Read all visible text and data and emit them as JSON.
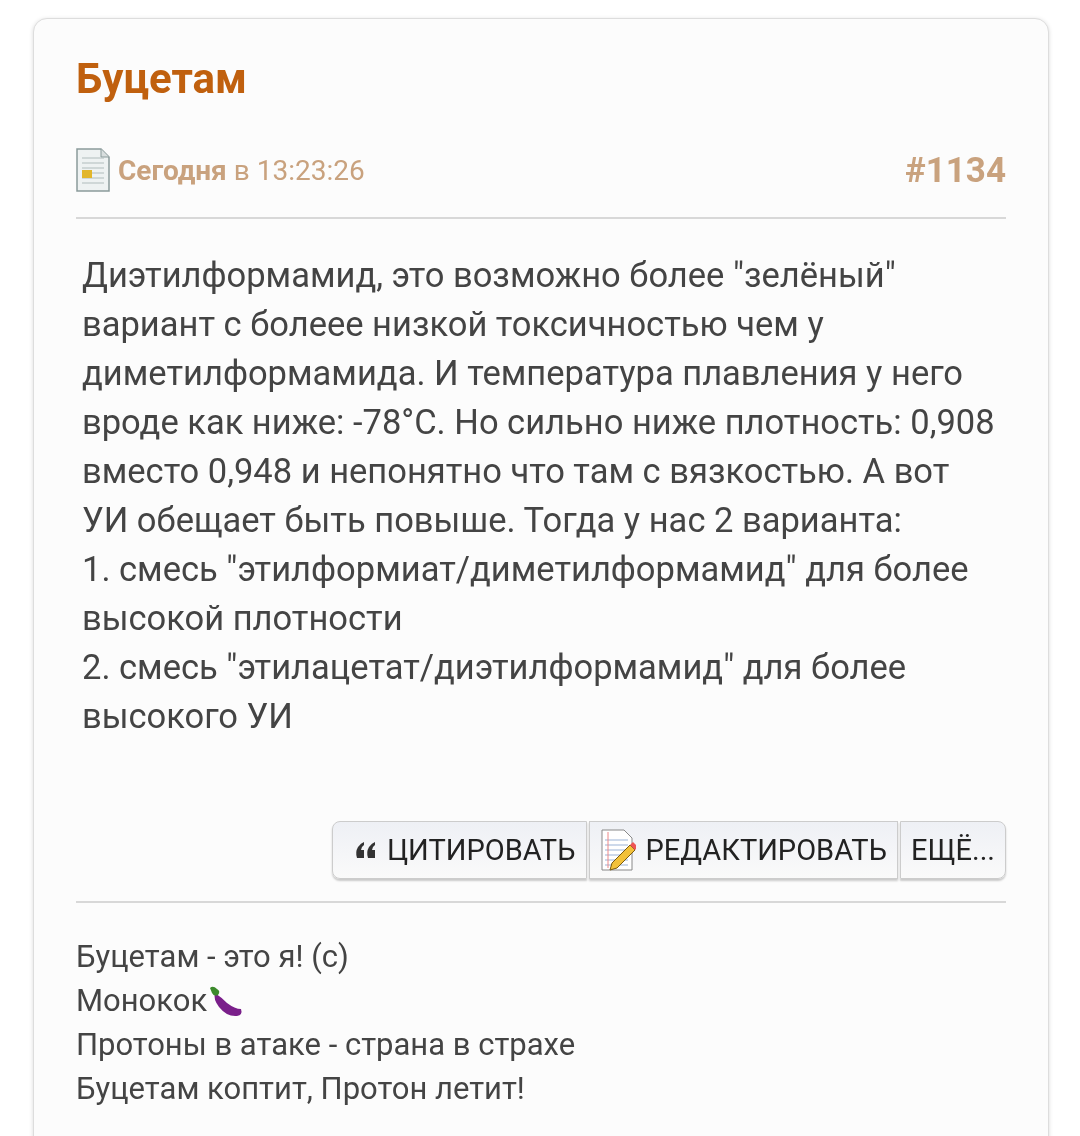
{
  "post": {
    "author": "Буцетам",
    "date_bold": "Сегодня",
    "date_rest": "в 13:23:26",
    "number": "#1134",
    "paragraphs": [
      "Диэтилформамид, это возможно более \"зелёный\" вариант с болеее низкой токсичностью чем у диметилформамида. И температура плавления у него вроде как ниже: -78°C. Но сильно ниже плотность: 0,908 вместо 0,948 и непонятно что там с вязкостью. А вот УИ обещает быть повыше. Тогда у нас 2 варианта:",
      "1. смесь \"этилформиат/диметилформамид\" для более высокой плотности",
      "2. смесь \"этилацетат/диэтилформамид\" для более высокого УИ"
    ],
    "buttons": [
      {
        "kind": "quote",
        "label": "ЦИТИРОВАТЬ"
      },
      {
        "kind": "edit",
        "label": "РЕДАКТИРОВАТЬ"
      },
      {
        "kind": "more",
        "label": "ЕЩЁ..."
      }
    ],
    "signature": [
      {
        "kind": "plain",
        "text": "Буцетам - это я! (с)"
      },
      {
        "kind": "eggplant",
        "text": "Монокок"
      },
      {
        "kind": "plain",
        "text": "Протоны в атаке - страна в страхе"
      },
      {
        "kind": "plain",
        "text": "Буцетам коптит, Протон летит!"
      }
    ]
  }
}
